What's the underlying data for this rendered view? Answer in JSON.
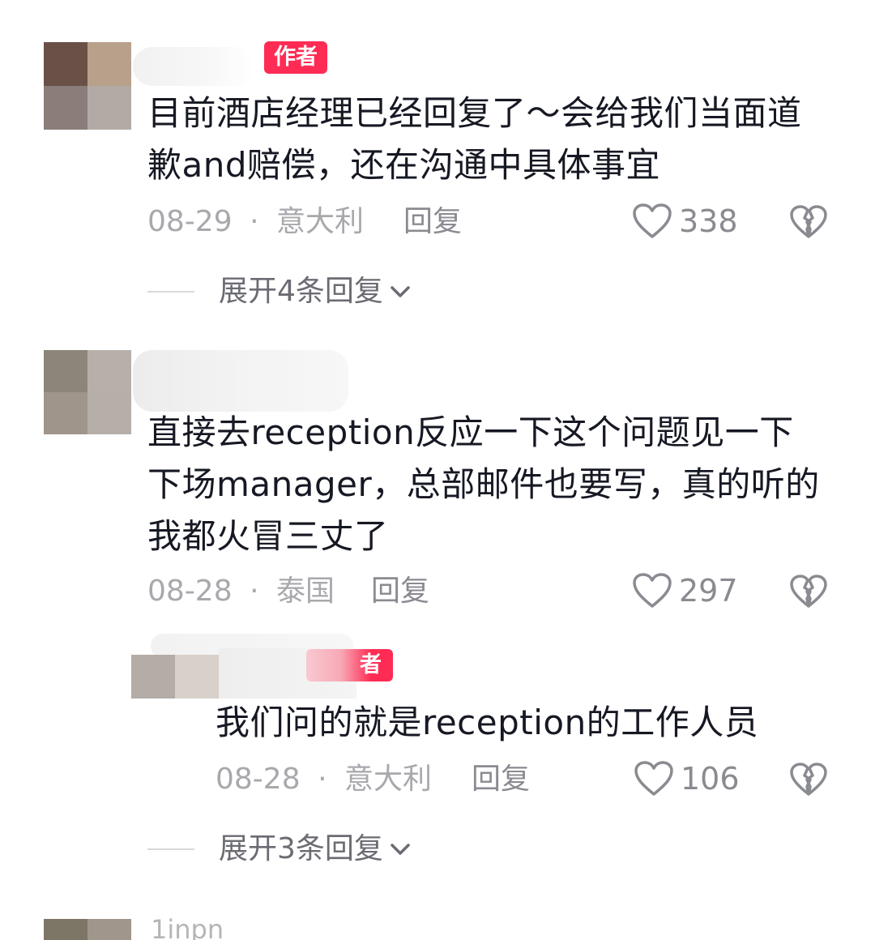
{
  "comments": [
    {
      "author_tag": "作者",
      "text": "目前酒店经理已经回复了～会给我们当面道歉and赔偿，还在沟通中具体事宜",
      "date": "08-29",
      "location": "意大利",
      "separator": "·",
      "reply_label": "回复",
      "likes": "338",
      "expand_label": "展开4条回复"
    },
    {
      "text": "直接去reception反应一下这个问题见一下下场manager，总部邮件也要写，真的听的我都火冒三丈了",
      "date": "08-28",
      "location": "泰国",
      "separator": "·",
      "reply_label": "回复",
      "likes": "297"
    },
    {
      "author_tag": "者",
      "text": "我们问的就是reception的工作人员",
      "date": "08-28",
      "location": "意大利",
      "separator": "·",
      "reply_label": "回复",
      "likes": "106",
      "expand_label": "展开3条回复"
    }
  ],
  "next_comment": {
    "partial_name": "1inpn"
  },
  "icons": {
    "like": "heart-outline-icon",
    "dislike": "broken-heart-icon",
    "expand": "chevron-down-icon"
  },
  "colors": {
    "author_tag": "#fe2c55",
    "meta_text": "#a8a8ad",
    "body_text": "#161823"
  }
}
